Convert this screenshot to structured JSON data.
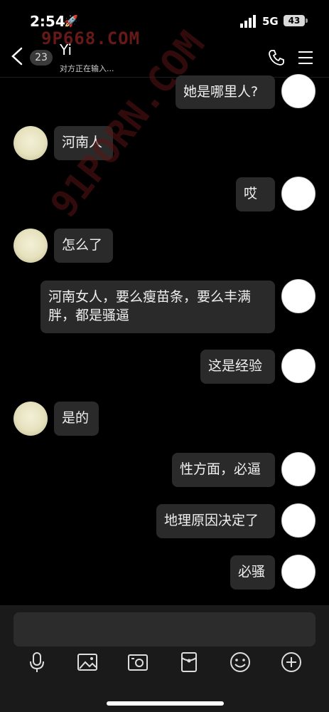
{
  "status": {
    "time": "2:54",
    "network": "5G",
    "battery": "43"
  },
  "watermarks": {
    "top": "9P668.COM",
    "diagonal": "91PORN.COM"
  },
  "header": {
    "unread_count": "23",
    "contact_name": "Yi",
    "subtitle": "对方正在输入..."
  },
  "messages": [
    {
      "from": "me",
      "text": "她是哪里人?"
    },
    {
      "from": "them",
      "text": "河南人"
    },
    {
      "from": "me",
      "text": "哎"
    },
    {
      "from": "them",
      "text": "怎么了"
    },
    {
      "from": "me",
      "text": "河南女人，要么瘦苗条，要么丰满胖，都是骚逼"
    },
    {
      "from": "me",
      "text": "这是经验"
    },
    {
      "from": "them",
      "text": "是的"
    },
    {
      "from": "me",
      "text": "性方面，必逼"
    },
    {
      "from": "me",
      "text": "地理原因决定了"
    },
    {
      "from": "me",
      "text": "必骚"
    }
  ],
  "toolbar": [
    "microphone-icon",
    "image-icon",
    "camera-icon",
    "red-packet-icon",
    "emoji-icon",
    "plus-icon"
  ]
}
